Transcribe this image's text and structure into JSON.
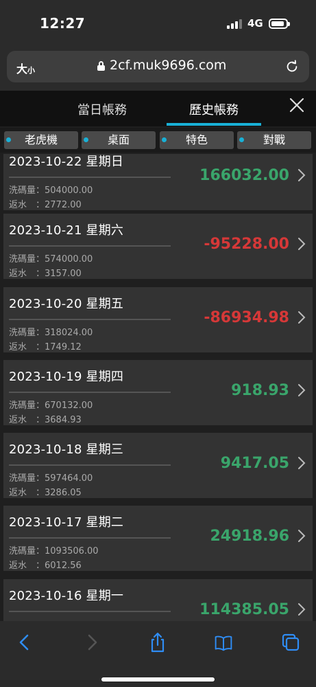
{
  "status_bar": {
    "time": "12:27",
    "network": "4G"
  },
  "address_bar": {
    "text_size_label": "大",
    "text_size_small": "小",
    "url": "2cf.muk9696.com"
  },
  "tabs": [
    {
      "label": "當日帳務",
      "active": false
    },
    {
      "label": "歷史帳務",
      "active": true
    }
  ],
  "filters": [
    {
      "label": "老虎機"
    },
    {
      "label": "桌面"
    },
    {
      "label": "特色"
    },
    {
      "label": "對戰"
    }
  ],
  "colors": {
    "accent": "#19b0d6",
    "positive": "#3aa56b",
    "negative": "#d63838"
  },
  "records": [
    {
      "date": "2023-10-22 星期日",
      "turnover": "洗碼量：504000.00",
      "rebate": "返水　：2772.00",
      "amount": "166032.00",
      "sign": "positive"
    },
    {
      "date": "2023-10-21 星期六",
      "turnover": "洗碼量：574000.00",
      "rebate": "返水　：3157.00",
      "amount": "-95228.00",
      "sign": "negative"
    },
    {
      "date": "2023-10-20 星期五",
      "turnover": "洗碼量：318024.00",
      "rebate": "返水　：1749.12",
      "amount": "-86934.98",
      "sign": "negative"
    },
    {
      "date": "2023-10-19 星期四",
      "turnover": "洗碼量：670132.00",
      "rebate": "返水　：3684.93",
      "amount": "918.93",
      "sign": "positive"
    },
    {
      "date": "2023-10-18 星期三",
      "turnover": "洗碼量：597464.00",
      "rebate": "返水　：3286.05",
      "amount": "9417.05",
      "sign": "positive"
    },
    {
      "date": "2023-10-17 星期二",
      "turnover": "洗碼量：1093506.00",
      "rebate": "返水　：6012.56",
      "amount": "24918.96",
      "sign": "positive"
    },
    {
      "date": "2023-10-16 星期一",
      "turnover": "",
      "rebate": "",
      "amount": "114385.05",
      "sign": "positive"
    }
  ]
}
